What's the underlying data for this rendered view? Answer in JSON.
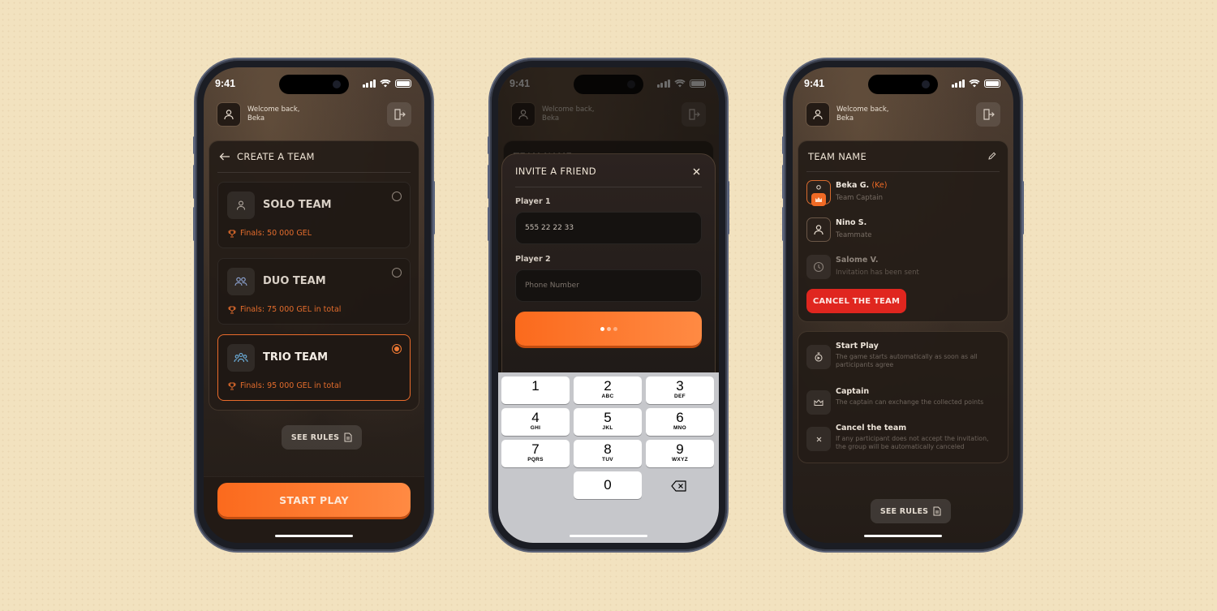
{
  "status_bar": {
    "time": "9:41"
  },
  "header": {
    "greeting": "Welcome back,",
    "user_name": "Beka"
  },
  "screen1": {
    "title": "CREATE A TEAM",
    "options": [
      {
        "name": "SOLO TEAM",
        "prize": "Finals: 50 000 GEL",
        "icon": "user-icon",
        "selected": false
      },
      {
        "name": "DUO TEAM",
        "prize": "Finals: 75 000 GEL in total",
        "icon": "users-icon",
        "selected": false
      },
      {
        "name": "TRIO TEAM",
        "prize": "Finals: 95 000 GEL in total",
        "icon": "group-icon",
        "selected": true
      }
    ],
    "see_rules": "SEE RULES",
    "start_play": "START PLAY"
  },
  "screen2": {
    "background_card_title": "TEAM NAME",
    "sheet_title": "INVITE A FRIEND",
    "player1_label": "Player 1",
    "player1_value": "555 22 22 33",
    "player2_label": "Player 2",
    "player2_placeholder": "Phone Number",
    "submit_state": "loading",
    "keypad": [
      {
        "digit": "1",
        "letters": ""
      },
      {
        "digit": "2",
        "letters": "ABC"
      },
      {
        "digit": "3",
        "letters": "DEF"
      },
      {
        "digit": "4",
        "letters": "GHI"
      },
      {
        "digit": "5",
        "letters": "JKL"
      },
      {
        "digit": "6",
        "letters": "MNO"
      },
      {
        "digit": "7",
        "letters": "PQRS"
      },
      {
        "digit": "8",
        "letters": "TUV"
      },
      {
        "digit": "9",
        "letters": "WXYZ"
      },
      {
        "digit": "0",
        "letters": ""
      }
    ]
  },
  "screen3": {
    "team_title": "TEAM NAME",
    "members": [
      {
        "name": "Beka G.",
        "tag": "(Ke)",
        "role": "Team Captain",
        "status": "captain"
      },
      {
        "name": "Nino S.",
        "tag": "",
        "role": "Teammate",
        "status": "joined"
      },
      {
        "name": "Salome V.",
        "tag": "",
        "role": "Invitation has been sent",
        "status": "pending"
      }
    ],
    "cancel_button": "CANCEL THE TEAM",
    "info": [
      {
        "title": "Start Play",
        "desc": "The game starts automatically as soon as all participants agree",
        "icon": "stopwatch-icon"
      },
      {
        "title": "Captain",
        "desc": "The captain can exchange the collected points",
        "icon": "crown-icon"
      },
      {
        "title": "Cancel the team",
        "desc": "If any participant does not accept the invitation, the group will be automatically canceled",
        "icon": "close-icon"
      }
    ],
    "see_rules": "SEE RULES"
  },
  "colors": {
    "accent": "#fb6a1d",
    "danger": "#e0261f",
    "background": "#f2e2bf"
  }
}
